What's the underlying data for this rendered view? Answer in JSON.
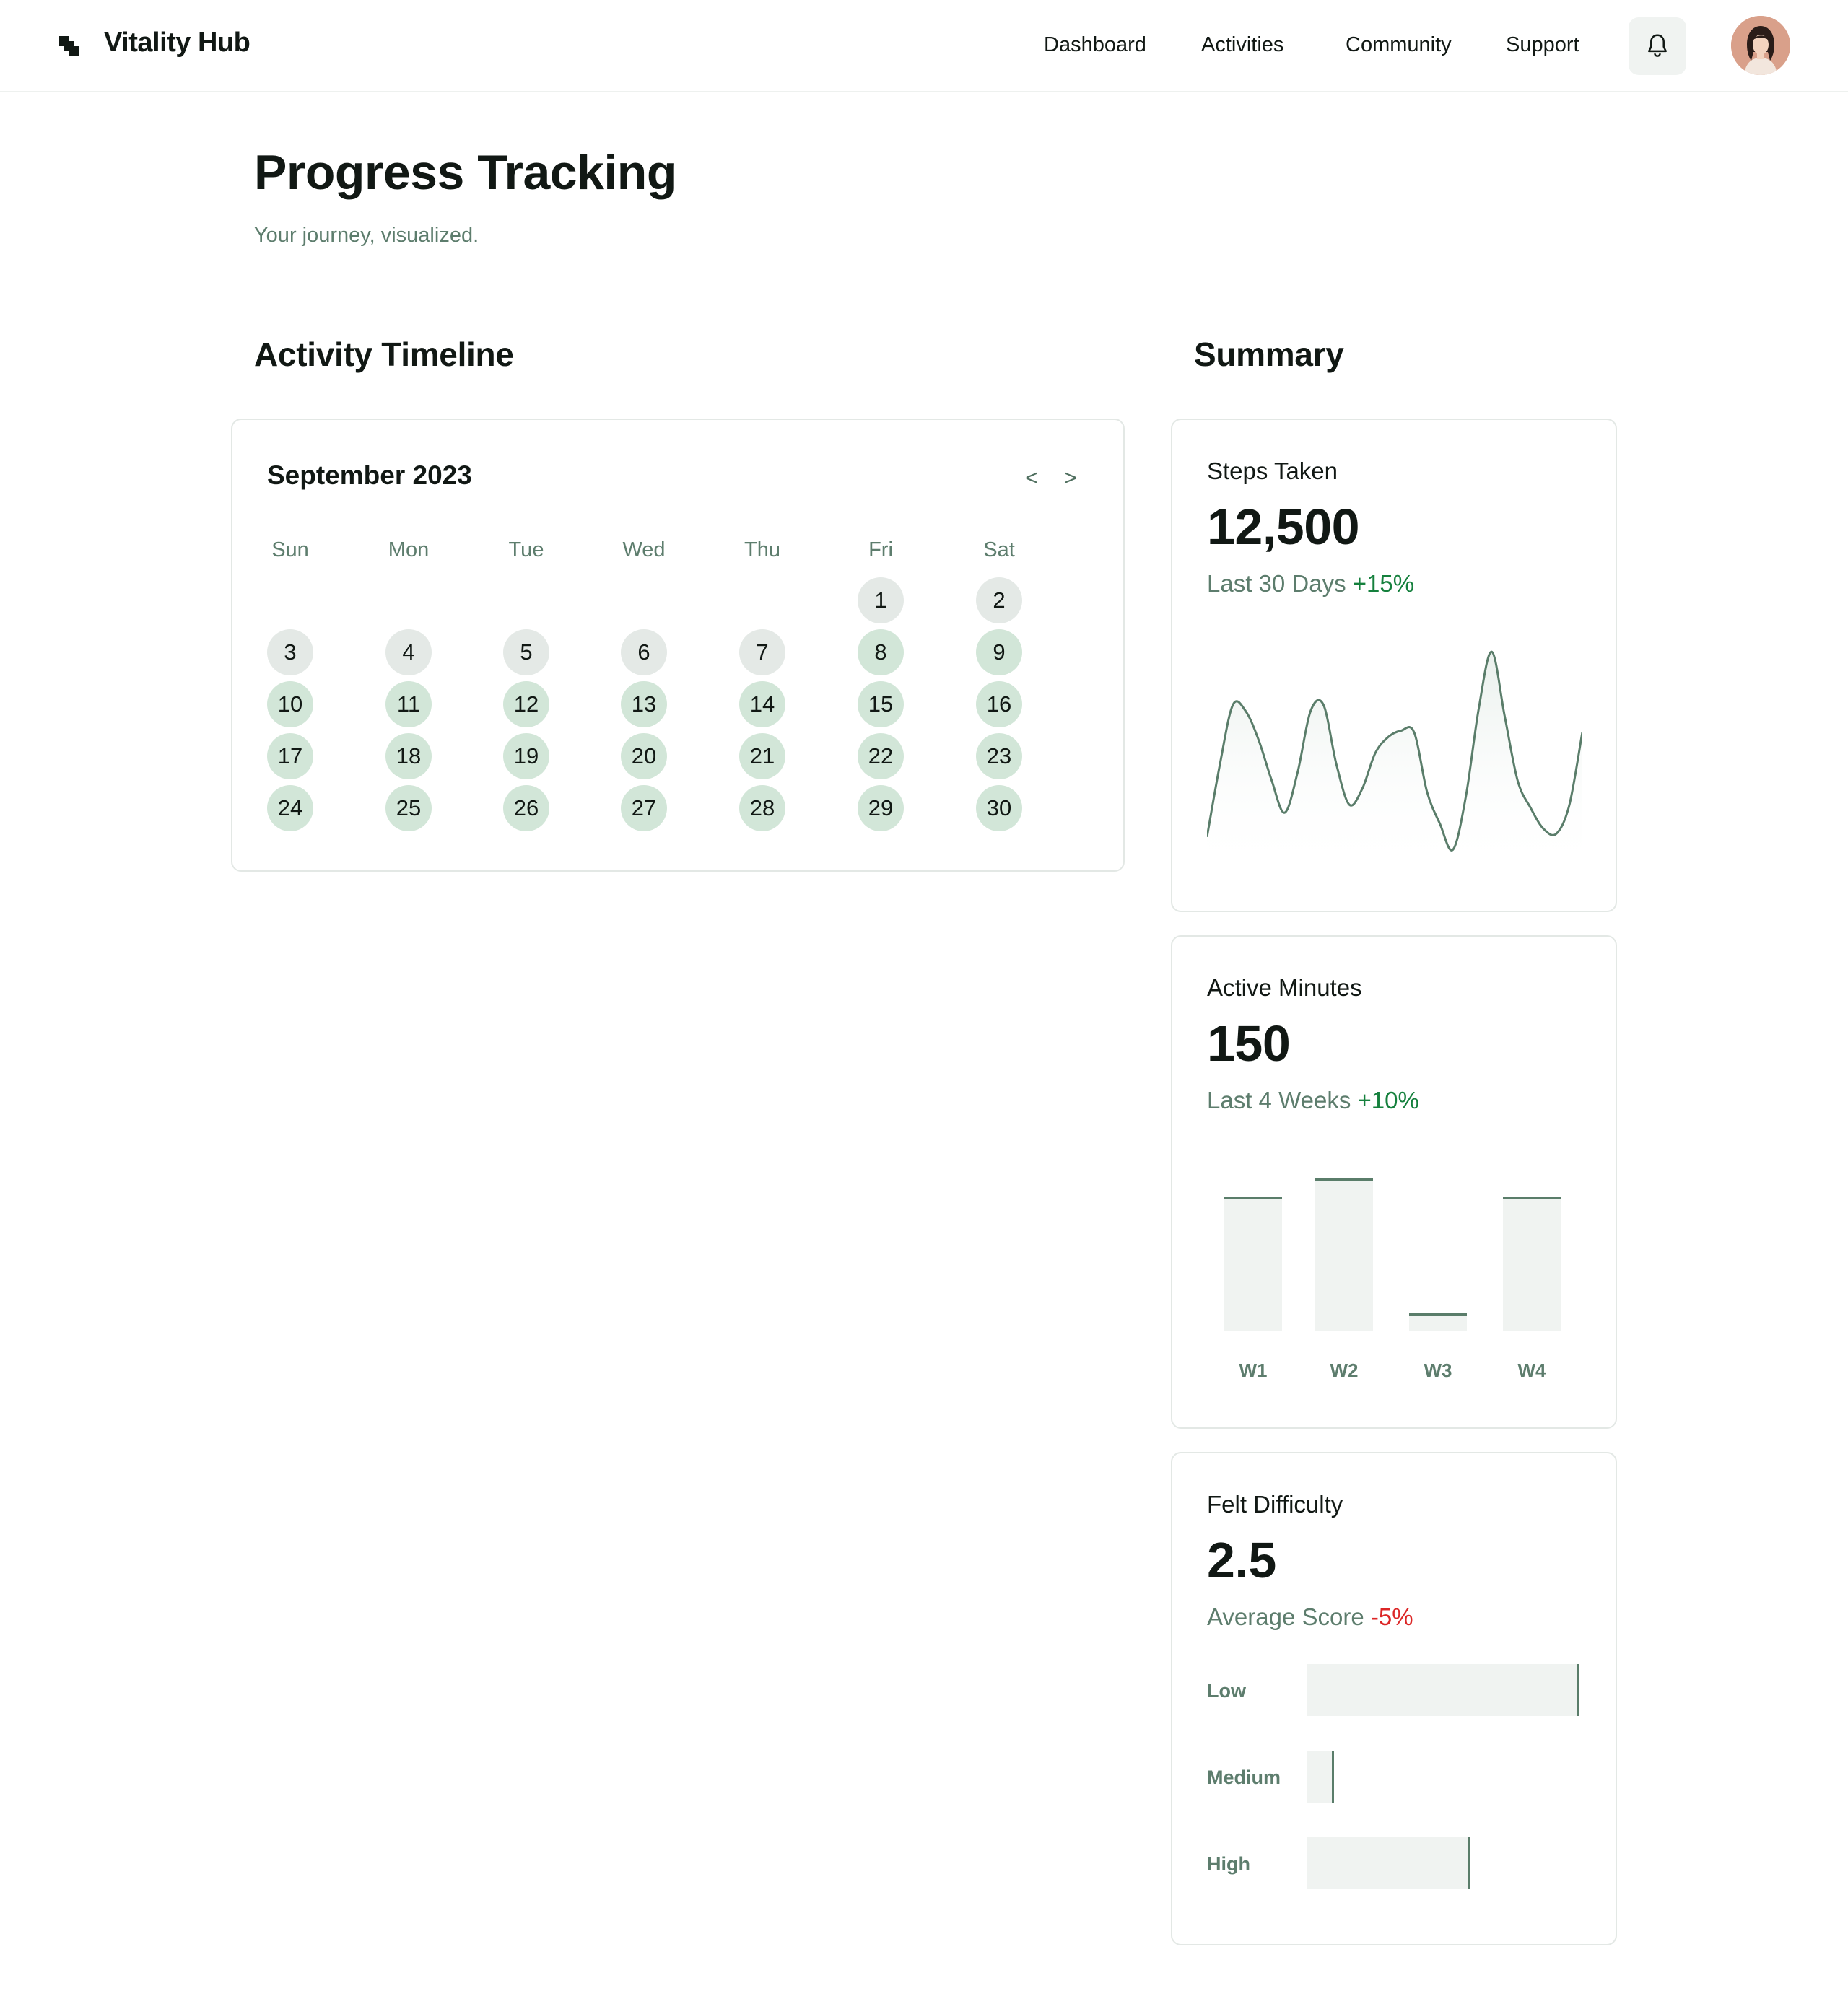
{
  "app": {
    "brand": "Vitality Hub",
    "nav": [
      "Dashboard",
      "Activities",
      "Community",
      "Support"
    ],
    "icons": {
      "logo": "logo-icon",
      "notifications": "bell-icon",
      "profile": "avatar"
    }
  },
  "page": {
    "title": "Progress Tracking",
    "subtitle": "Your journey, visualized."
  },
  "sections": {
    "timeline": "Activity Timeline",
    "summary": "Summary"
  },
  "calendar": {
    "month": "September 2023",
    "prev": "<",
    "next": ">",
    "weekdays": [
      "Sun",
      "Mon",
      "Tue",
      "Wed",
      "Thu",
      "Fri",
      "Sat"
    ],
    "first_weekday_index": 5,
    "days": [
      "1",
      "2",
      "3",
      "4",
      "5",
      "6",
      "7",
      "8",
      "9",
      "10",
      "11",
      "12",
      "13",
      "14",
      "15",
      "16",
      "17",
      "18",
      "19",
      "20",
      "21",
      "22",
      "23",
      "24",
      "25",
      "26",
      "27",
      "28",
      "29",
      "30"
    ],
    "day_status": [
      "light",
      "light",
      "light",
      "light",
      "light",
      "light",
      "light",
      "green",
      "green",
      "green",
      "green",
      "green",
      "green",
      "green",
      "green",
      "green",
      "green",
      "green",
      "green",
      "green",
      "green",
      "green",
      "green",
      "green",
      "green",
      "green",
      "green",
      "green",
      "green",
      "green"
    ]
  },
  "colors": {
    "accent": "#5a7d6a",
    "positive": "#15803d",
    "negative": "#dc2626",
    "muted_text": "#5d7d6d",
    "day_light": "#e4e9e6",
    "day_green": "#d2e6d8",
    "bar_fill": "#f0f3f1"
  },
  "summary": {
    "steps": {
      "label": "Steps Taken",
      "value": "12,500",
      "period": "Last 30 Days",
      "change": "+15%"
    },
    "active": {
      "label": "Active Minutes",
      "value": "150",
      "period": "Last 4 Weeks",
      "change": "+10%"
    },
    "difficulty": {
      "label": "Felt Difficulty",
      "value": "2.5",
      "period": "Average Score",
      "change": "-5%"
    }
  },
  "chart_data": [
    {
      "type": "area",
      "x": [
        0,
        1,
        2,
        3,
        4,
        5,
        6,
        7,
        8,
        9,
        10,
        11,
        12,
        13,
        14,
        15,
        16,
        17,
        18,
        19,
        20,
        21,
        22,
        23,
        24,
        25,
        26,
        27,
        28,
        29
      ],
      "values": [
        10,
        55,
        92,
        88,
        70,
        45,
        25,
        50,
        88,
        92,
        55,
        30,
        40,
        62,
        72,
        76,
        75,
        38,
        18,
        2,
        35,
        90,
        125,
        85,
        45,
        28,
        15,
        12,
        30,
        75
      ],
      "ylim": [
        0,
        130
      ],
      "grid": false,
      "legend": "none"
    },
    {
      "type": "bar",
      "categories": [
        "W1",
        "W2",
        "W3",
        "W4"
      ],
      "values": [
        85,
        97,
        11,
        85
      ],
      "ylim": [
        0,
        100
      ],
      "grid": false,
      "legend": "none"
    },
    {
      "type": "bar",
      "orientation": "horizontal",
      "categories": [
        "Low",
        "Medium",
        "High"
      ],
      "values": [
        100,
        10,
        60
      ],
      "ylim": [
        0,
        100
      ],
      "grid": false,
      "legend": "none"
    }
  ]
}
